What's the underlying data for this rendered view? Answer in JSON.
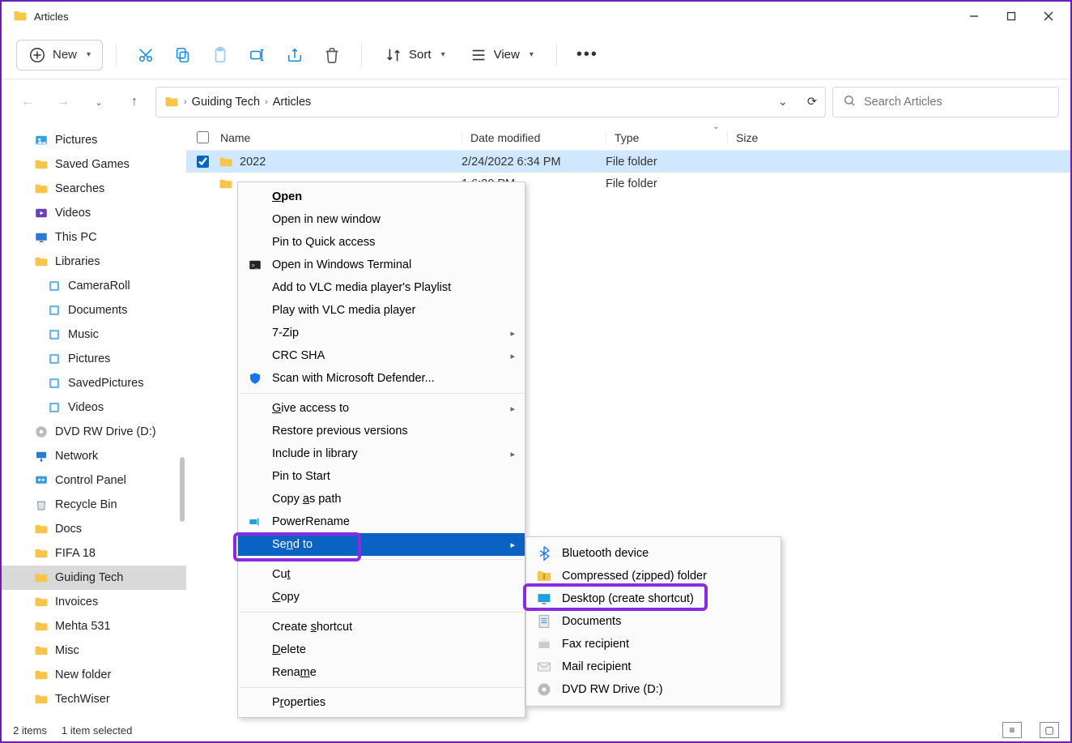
{
  "window": {
    "title": "Articles"
  },
  "toolbar": {
    "new": "New",
    "sort": "Sort",
    "view": "View"
  },
  "breadcrumb": {
    "items": [
      "Guiding Tech",
      "Articles"
    ]
  },
  "search": {
    "placeholder": "Search Articles"
  },
  "navpane": [
    {
      "label": "Pictures",
      "icon": "picture",
      "indent": false
    },
    {
      "label": "Saved Games",
      "icon": "folder",
      "indent": false
    },
    {
      "label": "Searches",
      "icon": "folder",
      "indent": false
    },
    {
      "label": "Videos",
      "icon": "video",
      "indent": false
    },
    {
      "label": "This PC",
      "icon": "pc",
      "indent": false
    },
    {
      "label": "Libraries",
      "icon": "folder",
      "indent": false
    },
    {
      "label": "CameraRoll",
      "icon": "library",
      "indent": true
    },
    {
      "label": "Documents",
      "icon": "library",
      "indent": true
    },
    {
      "label": "Music",
      "icon": "library",
      "indent": true
    },
    {
      "label": "Pictures",
      "icon": "library",
      "indent": true
    },
    {
      "label": "SavedPictures",
      "icon": "library",
      "indent": true
    },
    {
      "label": "Videos",
      "icon": "library",
      "indent": true
    },
    {
      "label": "DVD RW Drive (D:)",
      "icon": "disc",
      "indent": false
    },
    {
      "label": "Network",
      "icon": "network",
      "indent": false
    },
    {
      "label": "Control Panel",
      "icon": "control",
      "indent": false
    },
    {
      "label": "Recycle Bin",
      "icon": "recycle",
      "indent": false
    },
    {
      "label": "Docs",
      "icon": "folder",
      "indent": false
    },
    {
      "label": "FIFA 18",
      "icon": "folder",
      "indent": false
    },
    {
      "label": "Guiding Tech",
      "icon": "folder",
      "indent": false,
      "selected": true
    },
    {
      "label": "Invoices",
      "icon": "folder",
      "indent": false
    },
    {
      "label": "Mehta 531",
      "icon": "folder",
      "indent": false
    },
    {
      "label": "Misc",
      "icon": "folder",
      "indent": false
    },
    {
      "label": "New folder",
      "icon": "folder",
      "indent": false
    },
    {
      "label": "TechWiser",
      "icon": "folder",
      "indent": false
    }
  ],
  "columns": {
    "name": "Name",
    "date": "Date modified",
    "type": "Type",
    "size": "Size"
  },
  "rows": [
    {
      "name": "2022",
      "date": "2/24/2022 6:34 PM",
      "type": "File folder",
      "selected": true
    },
    {
      "name": "",
      "date": "1 6:20 PM",
      "type": "File folder",
      "selected": false
    }
  ],
  "context_menu": [
    {
      "label": "Open",
      "bold": true,
      "hotkey": "O"
    },
    {
      "label": "Open in new window"
    },
    {
      "label": "Pin to Quick access"
    },
    {
      "label": "Open in Windows Terminal",
      "icon": "terminal"
    },
    {
      "label": "Add to VLC media player's Playlist"
    },
    {
      "label": "Play with VLC media player"
    },
    {
      "label": "7-Zip",
      "submenu": true
    },
    {
      "label": "CRC SHA",
      "submenu": true
    },
    {
      "label": "Scan with Microsoft Defender...",
      "icon": "shield"
    },
    {
      "sep": true
    },
    {
      "label": "Give access to",
      "submenu": true,
      "hotkey": "G"
    },
    {
      "label": "Restore previous versions"
    },
    {
      "label": "Include in library",
      "submenu": true
    },
    {
      "label": "Pin to Start"
    },
    {
      "label": "Copy as path",
      "hotkey": "a"
    },
    {
      "label": "PowerRename",
      "icon": "rename"
    },
    {
      "label": "Send to",
      "submenu": true,
      "highlight": true,
      "hotkey": "n"
    },
    {
      "sep": true
    },
    {
      "label": "Cut",
      "hotkey": "t"
    },
    {
      "label": "Copy",
      "hotkey": "C"
    },
    {
      "sep": true
    },
    {
      "label": "Create shortcut",
      "hotkey": "s"
    },
    {
      "label": "Delete",
      "hotkey": "D"
    },
    {
      "label": "Rename",
      "hotkey": "m"
    },
    {
      "sep": true
    },
    {
      "label": "Properties",
      "hotkey": "r"
    }
  ],
  "send_to_submenu": [
    {
      "label": "Bluetooth device",
      "icon": "bluetooth"
    },
    {
      "label": "Compressed (zipped) folder",
      "icon": "zip"
    },
    {
      "label": "Desktop (create shortcut)",
      "icon": "desktop",
      "annot": true
    },
    {
      "label": "Documents",
      "icon": "doc"
    },
    {
      "label": "Fax recipient",
      "icon": "fax"
    },
    {
      "label": "Mail recipient",
      "icon": "mail"
    },
    {
      "label": "DVD RW Drive (D:)",
      "icon": "disc"
    }
  ],
  "status": {
    "count": "2 items",
    "selected": "1 item selected"
  }
}
